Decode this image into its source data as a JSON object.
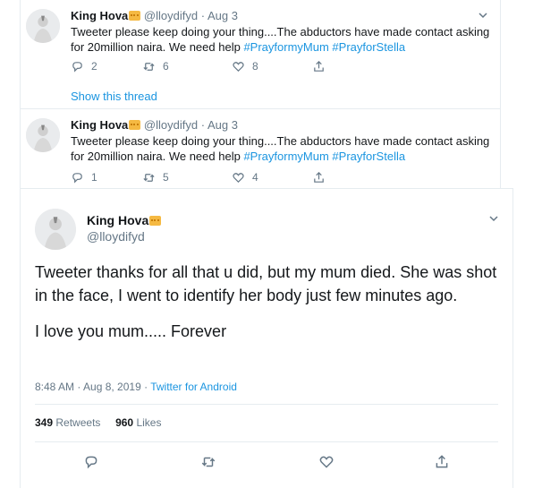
{
  "tweet1": {
    "name": "King Hova",
    "handle": "@lloydifyd",
    "dot": "·",
    "date": "Aug 3",
    "text": "Tweeter please keep doing your thing....The abductors have made contact asking for 20million naira. We need help ",
    "hashtags": [
      "#PrayformyMum",
      "#PrayforStella"
    ],
    "replies": "2",
    "retweets": "6",
    "likes": "8",
    "show_thread": "Show this thread"
  },
  "tweet2": {
    "name": "King Hova",
    "handle": "@lloydifyd",
    "dot": "·",
    "date": "Aug 3",
    "text": "Tweeter please keep doing your thing....The abductors have made contact asking for 20million naira. We need help ",
    "hashtags": [
      "#PrayformyMum",
      "#PrayforStella"
    ],
    "replies": "1",
    "retweets": "5",
    "likes": "4"
  },
  "main_tweet": {
    "name": "King Hova",
    "handle": "@lloydifyd",
    "paragraph1": "Tweeter thanks for all that u did,  but my mum died.  She was shot in the face,  I went to identify her body just few minutes ago.",
    "paragraph2": "I love you mum..... Forever",
    "timestamp": "8:48 AM · Aug 8, 2019 · ",
    "source": "Twitter for Android",
    "retweets_count": "349",
    "retweets_label": "Retweets",
    "likes_count": "960",
    "likes_label": "Likes"
  },
  "icons": {
    "reply": "reply-icon",
    "retweet": "retweet-icon",
    "like": "heart-icon",
    "share": "share-icon",
    "menu": "chevron-down-icon",
    "emoji": "crown-emoji-icon"
  },
  "colors": {
    "link": "#1b95e0",
    "muted": "#657786",
    "text": "#14171a",
    "border": "#e6ecf0"
  }
}
